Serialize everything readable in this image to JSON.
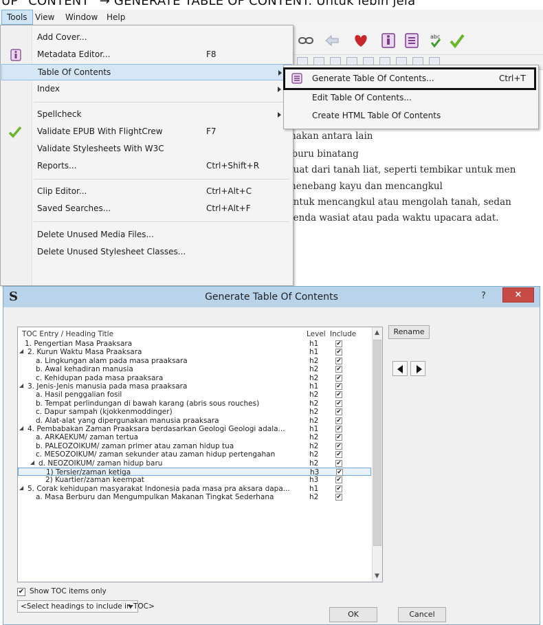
{
  "top_caption": "UP “CONTENT” → GENERATE TABLE OF CONTENT. Untuk lebih jela",
  "menubar": {
    "items": [
      "Tools",
      "View",
      "Window",
      "Help"
    ]
  },
  "document_lines": [
    "makan antara lain",
    "rburu binatang",
    "buat dari tanah liat, seperti tembikar untuk men",
    "menebang kayu dan mencangkul",
    "untuk mencangkul atau mengolah tanah, sedan",
    "benda wasiat atau pada waktu upacara adat."
  ],
  "tools_menu": {
    "add_cover": "Add Cover...",
    "metadata_editor": "Metadata Editor...",
    "metadata_editor_sc": "F8",
    "table_of_contents": "Table Of Contents",
    "index": "Index",
    "spellcheck": "Spellcheck",
    "validate_epub": "Validate EPUB With FlightCrew",
    "validate_epub_sc": "F7",
    "validate_css": "Validate Stylesheets With W3C",
    "reports": "Reports...",
    "reports_sc": "Ctrl+Shift+R",
    "clip_editor": "Clip Editor...",
    "clip_editor_sc": "Ctrl+Alt+C",
    "saved_searches": "Saved Searches...",
    "saved_searches_sc": "Ctrl+Alt+F",
    "delete_media": "Delete Unused Media Files...",
    "delete_classes": "Delete Unused Stylesheet Classes..."
  },
  "toc_submenu": {
    "generate": "Generate Table Of Contents...",
    "generate_sc": "Ctrl+T",
    "edit": "Edit Table Of Contents...",
    "create_html": "Create HTML Table Of Contents"
  },
  "dialog": {
    "title": "Generate Table Of Contents",
    "help": "?",
    "close": "×",
    "logo": "S",
    "col_title": "TOC Entry / Heading Title",
    "col_level": "Level",
    "col_include": "Include",
    "rename": "Rename",
    "show_toc_only": "Show TOC items only",
    "select_headings": "<Select headings to include in TOC>",
    "ok": "OK",
    "cancel": "Cancel",
    "rows": [
      {
        "title": "1. Pengertian Masa Praaksara",
        "level": "h1",
        "include": "✔"
      },
      {
        "title": "2. Kurun Waktu Masa Praaksara",
        "level": "h1",
        "include": "✔"
      },
      {
        "title": "a. Lingkungan alam pada masa praaksara",
        "level": "h2",
        "include": "✔"
      },
      {
        "title": "b. Awal kehadiran manusia",
        "level": "h2",
        "include": "✔"
      },
      {
        "title": "c. Kehidupan pada masa praaksara",
        "level": "h2",
        "include": "✔"
      },
      {
        "title": "3. Jenis-Jenis manusia pada masa praaksara",
        "level": "h1",
        "include": "✔"
      },
      {
        "title": "a. Hasil penggalian fosil",
        "level": "h2",
        "include": "✔"
      },
      {
        "title": "b. Tempat perlindungan di bawah karang (abris sous rouches)",
        "level": "h2",
        "include": "✔"
      },
      {
        "title": "c. Dapur sampah (kjokkenmoddinger)",
        "level": "h2",
        "include": "✔"
      },
      {
        "title": "d. Alat-alat yang dipergunakan manusia praaksara",
        "level": "h2",
        "include": "✔"
      },
      {
        "title": "4. Pembabakan Zaman Praaksara berdasarkan Geologi Geologi adala...",
        "level": "h1",
        "include": "✔"
      },
      {
        "title": "a. ARKAEKUM/ zaman tertua",
        "level": "h2",
        "include": "✔"
      },
      {
        "title": "b. PALEOZOIKUM/ zaman primer atau zaman hidup tua",
        "level": "h2",
        "include": "✔"
      },
      {
        "title": "c. MESOZOIKUM/ zaman sekunder atau zaman hidup pertengahan",
        "level": "h2",
        "include": "✔"
      },
      {
        "title": "d. NEOZOIKUM/ zaman hidup baru",
        "level": "h2",
        "include": "✔"
      },
      {
        "title": "1) Tersier/zaman ketiga",
        "level": "h3",
        "include": "✔"
      },
      {
        "title": "2) Kuartier/zaman keempat",
        "level": "h3",
        "include": "✔"
      },
      {
        "title": "5. Corak kehidupan masyarakat Indonesia pada masa pra aksara dapa...",
        "level": "h1",
        "include": "✔"
      },
      {
        "title": "a. Masa Berburu dan Mengumpulkan Makanan Tingkat Sederhana",
        "level": "h2",
        "include": "✔"
      }
    ]
  }
}
